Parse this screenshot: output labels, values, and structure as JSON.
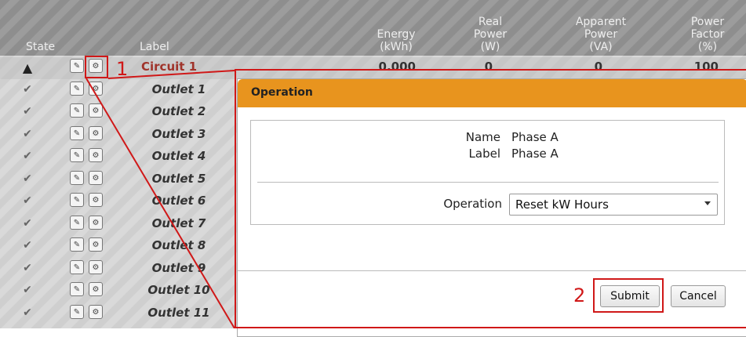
{
  "columns": {
    "state": "State",
    "label": "Label",
    "energy": [
      "Energy",
      "(kWh)"
    ],
    "real_power": [
      "Real",
      "Power",
      "(W)"
    ],
    "apparent_power": [
      "Apparent",
      "Power",
      "(VA)"
    ],
    "power_factor": [
      "Power",
      "Factor",
      "(%)"
    ]
  },
  "rows": [
    {
      "state_icon": "warning-icon",
      "label": "Circuit 1",
      "energy": "0.000",
      "real_power": "0",
      "apparent_power": "0",
      "power_factor": "100"
    },
    {
      "state_icon": "check-icon",
      "label": "Outlet 1"
    },
    {
      "state_icon": "check-icon",
      "label": "Outlet 2"
    },
    {
      "state_icon": "check-icon",
      "label": "Outlet 3"
    },
    {
      "state_icon": "check-icon",
      "label": "Outlet 4"
    },
    {
      "state_icon": "check-icon",
      "label": "Outlet 5"
    },
    {
      "state_icon": "check-icon",
      "label": "Outlet 6"
    },
    {
      "state_icon": "check-icon",
      "label": "Outlet 7"
    },
    {
      "state_icon": "check-icon",
      "label": "Outlet 8"
    },
    {
      "state_icon": "check-icon",
      "label": "Outlet 9"
    },
    {
      "state_icon": "check-icon",
      "label": "Outlet 10"
    },
    {
      "state_icon": "check-icon",
      "label": "Outlet 11"
    }
  ],
  "modal": {
    "title": "Operation",
    "name_label": "Name",
    "name_value": "Phase A",
    "label_label": "Label",
    "label_value": "Phase A",
    "operation_label": "Operation",
    "operation_value": "Reset kW Hours",
    "submit": "Submit",
    "cancel": "Cancel"
  },
  "callouts": {
    "one": "1",
    "two": "2"
  },
  "colors": {
    "header": "#e8941e",
    "callout": "#d01818",
    "circuit_label": "#a0342b"
  }
}
